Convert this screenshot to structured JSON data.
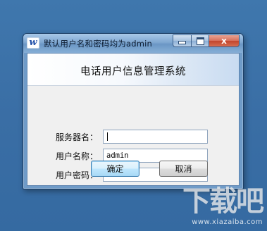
{
  "window": {
    "icon_glyph": "w",
    "title": "默认用户名和密码均为admin",
    "close_glyph": "x"
  },
  "dialog": {
    "heading": "电话用户信息管理系统",
    "fields": [
      {
        "label": "服务器名：",
        "value": ""
      },
      {
        "label": "用户名称：",
        "value": "admin"
      },
      {
        "label": "用户密码：",
        "value": "*****"
      }
    ],
    "ok_label": "确定",
    "cancel_label": "取消"
  },
  "watermark": {
    "big": "下载吧",
    "small": "www.xiazaiba.com"
  },
  "colors": {
    "desktop": "#3a6ea5",
    "titlebar": "#7fa7d1",
    "close_button": "#c2452c",
    "dialog_bg": "#f0f0f0"
  },
  "icons": [
    "app-icon",
    "minimize-icon",
    "maximize-icon",
    "close-icon"
  ]
}
